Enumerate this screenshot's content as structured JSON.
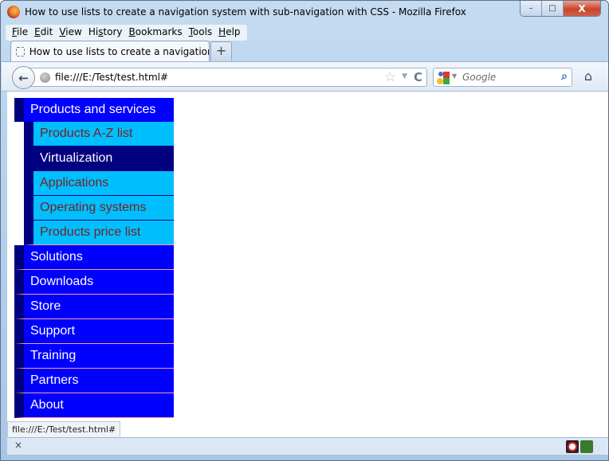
{
  "window": {
    "title": "How to use lists to create a navigation system with sub-navigation with CSS - Mozilla Firefox",
    "controls": {
      "minimize": "–",
      "maximize": "□",
      "close": "X"
    }
  },
  "menubar": {
    "items": [
      {
        "accel": "F",
        "rest": "ile"
      },
      {
        "accel": "E",
        "rest": "dit"
      },
      {
        "accel": "V",
        "rest": "iew"
      },
      {
        "pre": "Hi",
        "accel": "s",
        "rest": "tory"
      },
      {
        "accel": "B",
        "rest": "ookmarks"
      },
      {
        "accel": "T",
        "rest": "ools"
      },
      {
        "accel": "H",
        "rest": "elp"
      }
    ]
  },
  "tabs": [
    {
      "label": "How to use lists to create a navigation sy...",
      "active": true
    }
  ],
  "newtab_label": "+",
  "navbar": {
    "back_icon": "←",
    "url": "file:///E:/Test/test.html#",
    "star_icon": "☆",
    "dropdown_icon": "▼",
    "reload_icon": "C",
    "search_placeholder": "Google",
    "search_go_icon": "⌕",
    "home_icon": "⌂"
  },
  "page": {
    "nav": {
      "first": {
        "label": "Products and services"
      },
      "subitems": [
        {
          "label": "Products A-Z list",
          "active": false
        },
        {
          "label": "Virtualization",
          "active": true
        },
        {
          "label": "Applications",
          "active": false
        },
        {
          "label": "Operating systems",
          "active": false
        },
        {
          "label": "Products price list",
          "active": false
        }
      ],
      "items": [
        {
          "label": "Solutions"
        },
        {
          "label": "Downloads"
        },
        {
          "label": "Store"
        },
        {
          "label": "Support"
        },
        {
          "label": "Training"
        },
        {
          "label": "Partners"
        },
        {
          "label": "About"
        }
      ]
    },
    "colors": {
      "nav_bg": "#0000ff",
      "nav_border": "#000080",
      "subnav_bg": "#00bfff",
      "subnav_active_bg": "#000080",
      "subnav_text": "#7a1f1f",
      "separator": "#ff9aaa"
    }
  },
  "status": {
    "link_preview": "file:///E:/Test/test.html#",
    "addonbar_close": "×"
  }
}
